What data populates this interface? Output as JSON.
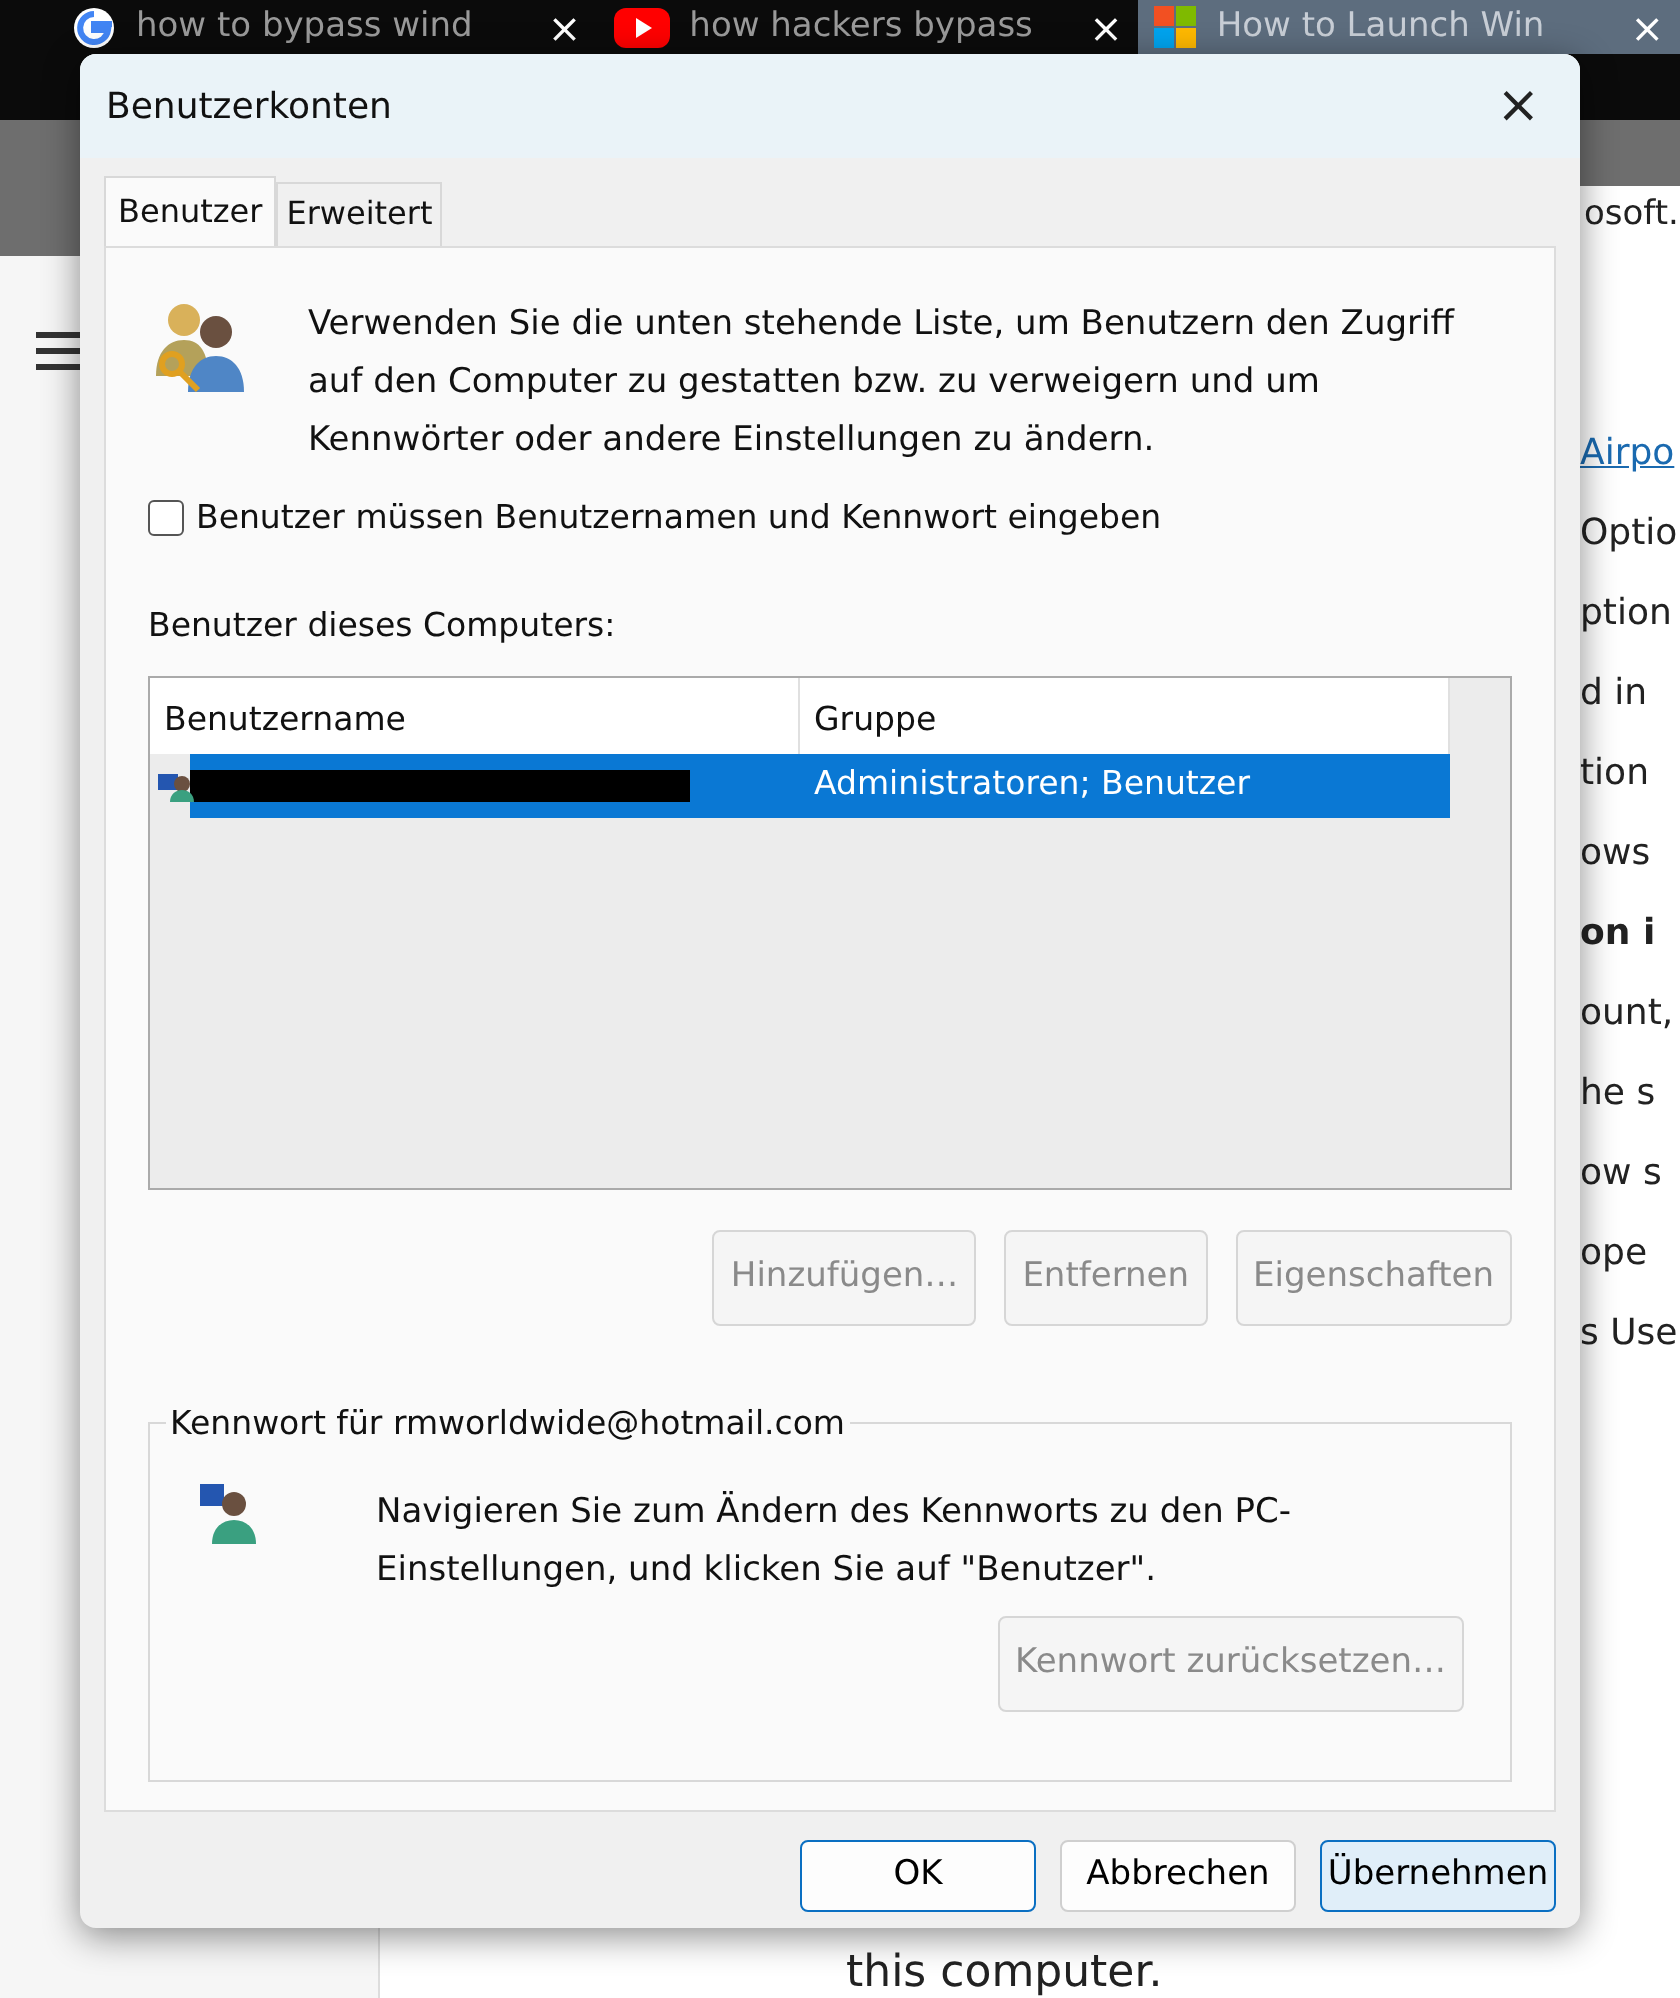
{
  "browser": {
    "tabs": [
      {
        "title": "how to bypass wind",
        "kind": "ring",
        "selected": false,
        "close": "×"
      },
      {
        "title": "how hackers bypass",
        "kind": "play",
        "selected": false,
        "close": "×"
      },
      {
        "title": "How to Launch Win",
        "kind": "squares",
        "selected": true,
        "close": "×"
      }
    ],
    "address_fragment": "osoft.",
    "page_fragments": [
      {
        "text": "Airpo",
        "kind": "link"
      },
      {
        "text": "Optio",
        "kind": "plain"
      },
      {
        "text": "ption",
        "kind": "plain"
      },
      {
        "text": "d in",
        "kind": "plain"
      },
      {
        "text": "tion",
        "kind": "plain"
      },
      {
        "text": "ows",
        "kind": "plain"
      },
      {
        "text": "on i",
        "kind": "bold"
      },
      {
        "text": "ount,",
        "kind": "plain"
      },
      {
        "text": "he s",
        "kind": "plain"
      },
      {
        "text": "ow s",
        "kind": "plain"
      },
      {
        "text": "ope",
        "kind": "plain"
      },
      {
        "text": "s Use",
        "kind": "plain"
      }
    ],
    "bottom_text": "this computer."
  },
  "dialog": {
    "title": "Benutzerkonten",
    "close": "×",
    "tabs": [
      {
        "label": "Benutzer",
        "selected": true
      },
      {
        "label": "Erweitert",
        "selected": false
      }
    ],
    "intro": "Verwenden Sie die unten stehende Liste, um Benutzern den Zugriff auf den Computer zu gestatten bzw. zu verweigern und um Kennwörter oder andere Einstellungen zu ändern.",
    "login_checkbox": {
      "label": "Benutzer müssen Benutzernamen und Kennwort eingeben",
      "checked": false
    },
    "users_label": "Benutzer dieses Computers:",
    "table": {
      "columns": [
        "Benutzername",
        "Gruppe"
      ],
      "rows": [
        {
          "username_redacted": true,
          "group": "Administratoren; Benutzer",
          "selected": true
        }
      ]
    },
    "list_buttons": [
      {
        "label": "Hinzufügen…",
        "disabled": true
      },
      {
        "label": "Entfernen",
        "disabled": true
      },
      {
        "label": "Eigenschaften",
        "disabled": true
      }
    ],
    "password_group": {
      "legend": "Kennwort für rmworldwide@hotmail.com",
      "text": "Navigieren Sie zum Ändern des Kennworts zu den PC-Einstellungen, und klicken Sie auf \"Benutzer\".",
      "button": {
        "label": "Kennwort zurücksetzen…",
        "disabled": true
      }
    },
    "footer_buttons": [
      {
        "label": "OK",
        "kind": "default"
      },
      {
        "label": "Abbrechen",
        "kind": "plain"
      },
      {
        "label": "Übernehmen",
        "kind": "hot"
      }
    ]
  }
}
